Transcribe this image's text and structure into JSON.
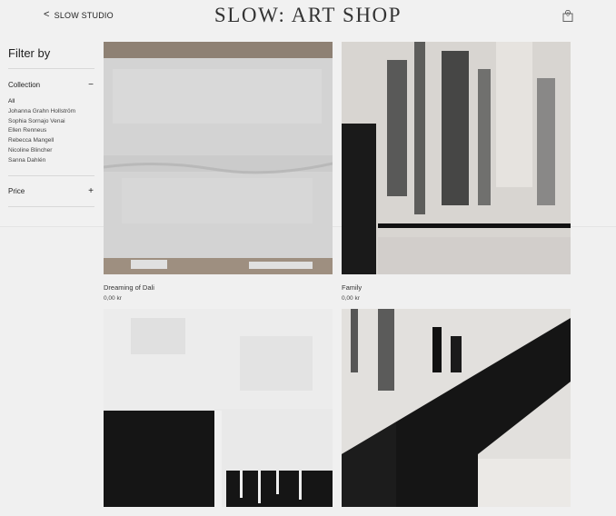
{
  "header": {
    "back_label": "SLOW STUDIO",
    "title": "SLOW: ART SHOP",
    "cart_count": "0",
    "back_icon": "chevron-left-icon",
    "cart_icon": "shopping-bag-icon"
  },
  "sidebar": {
    "title": "Filter by",
    "collection": {
      "label": "Collection",
      "toggle": "−",
      "items": [
        "All",
        "Johanna Grahn Hollström",
        "Sophia Sornajo Venai",
        "Ellen Renneus",
        "Rebecca Mangell",
        "Nicoline Blincher",
        "Sanna Dahlén"
      ]
    },
    "price": {
      "label": "Price",
      "toggle": "+"
    }
  },
  "products": [
    {
      "name": "Dreaming of Dali",
      "price": "0,00 kr"
    },
    {
      "name": "Family",
      "price": "0,00 kr"
    },
    {
      "name": "",
      "price": ""
    },
    {
      "name": "",
      "price": ""
    }
  ],
  "colors": {
    "background": "#f1f1f1",
    "text": "#222222",
    "divider": "#d8d8d8"
  }
}
